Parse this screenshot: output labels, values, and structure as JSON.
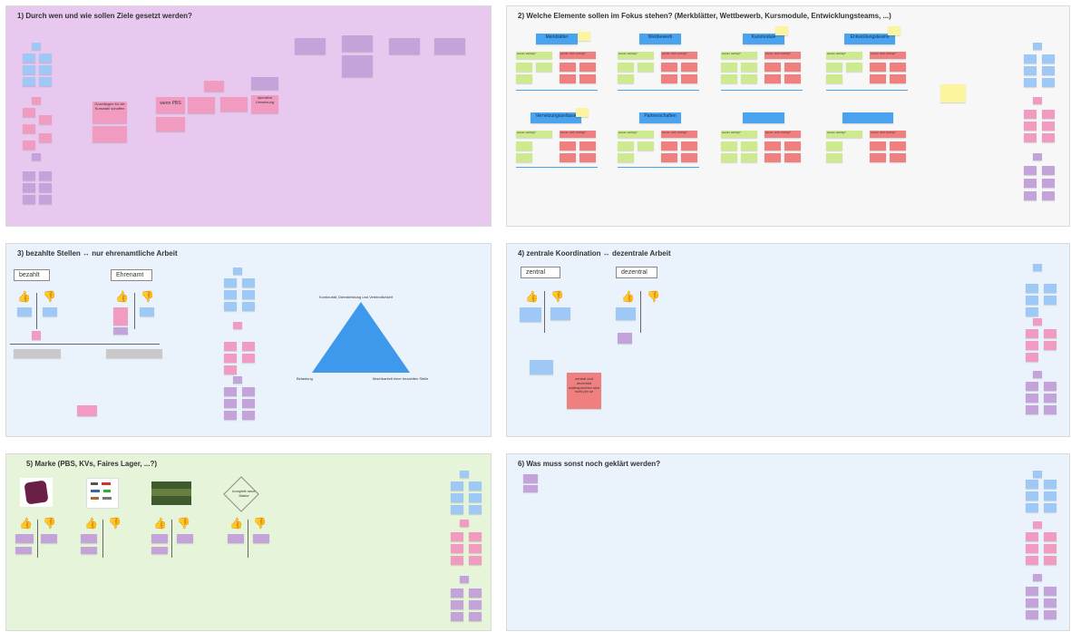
{
  "frames": [
    {
      "title": "1) Durch wen und wie sollen Ziele gesetzt  werden?",
      "color": "#e8c8ee"
    },
    {
      "title": "2) Welche Elemente sollen im Fokus stehen? (Merkblätter, Wettbewerb, Kursmodule, Entwicklungsteams, ...)",
      "color": "#f7f7f7"
    },
    {
      "title": "3) bezahlte Stellen ↔ nur ehrenamtliche Arbeit",
      "color": "#eaf3fc"
    },
    {
      "title": "4) zentrale Koordination ↔ dezentrale Arbeit",
      "color": "#eaf3fc"
    },
    {
      "title": "5) Marke (PBS, KVs, Faires Lager, ...?)",
      "color": "#e6f4d9"
    },
    {
      "title": "6) Was muss sonst noch geklärt werden?",
      "color": "#eaf3fc"
    }
  ],
  "f1": {
    "notes": [
      "Grundlagen für die Kurswahl schaffen",
      "wenn PBS",
      "operative Umsetzung"
    ]
  },
  "f2": {
    "headers": [
      "Merkblätter",
      "Wettbewerb",
      "Kursmodule",
      "Entwicklungsteams",
      "Vernetzungsanlässe",
      "Partnerschaften",
      "",
      ""
    ],
    "pro": "warum wichtig?",
    "con": "warum nicht wichtig?"
  },
  "f3": {
    "left_label": "bezahlt",
    "right_label": "Ehrenamt",
    "triangle_top": "Kontinuität, Dienstleistung und Verbindlichkeit",
    "triangle_left": "Belastung",
    "triangle_right": "Machbarkeit einer bezahlten Stelle"
  },
  "f4": {
    "left_label": "zentral",
    "right_label": "dezentral",
    "note": "zentral und dezentral widersprechen sich nicht per se"
  },
  "f5": {
    "brand_text": "komplett neue Marke"
  },
  "icons": {
    "thumbs_up": "👍",
    "thumbs_down": "👎"
  },
  "colors": {
    "hdr": "#4aa3ee",
    "pink": "#f29bc0",
    "blue": "#9ec8f5",
    "purple": "#c3a3d9",
    "green": "#cdea8e",
    "red": "#f07f7f"
  }
}
